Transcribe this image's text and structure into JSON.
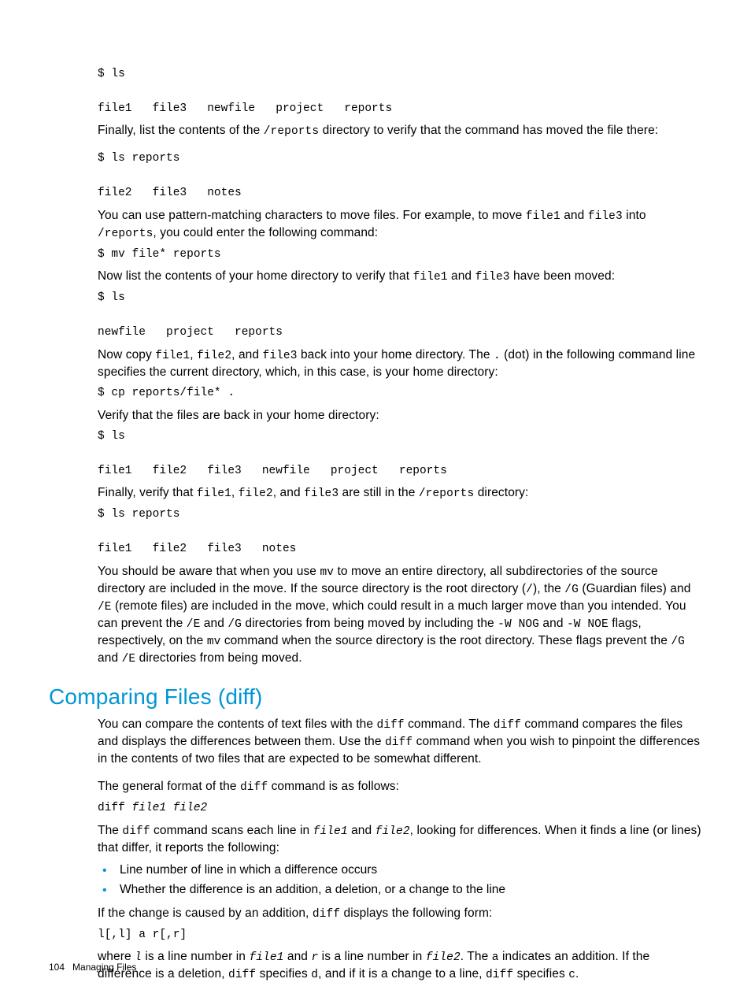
{
  "code1": "$ ls\n\nfile1   file3   newfile   project   reports",
  "para1_a": "Finally, list the contents of the ",
  "para1_code1": "/reports",
  "para1_b": " directory to verify that the command has moved the file there:",
  "code2": "$ ls reports\n\nfile2   file3   notes",
  "para2_a": "You can use pattern-matching characters to move files. For example, to move ",
  "para2_code1": "file1",
  "para2_b": " and ",
  "para2_code2": "file3",
  "para2_c": " into ",
  "para2_code3": "/reports",
  "para2_d": ", you could enter the following command:",
  "code3": "$ mv file* reports",
  "para3_a": "Now list the contents of your home directory to verify that ",
  "para3_code1": "file1",
  "para3_b": " and ",
  "para3_code2": "file3",
  "para3_c": " have been moved:",
  "code4": "$ ls\n\nnewfile   project   reports",
  "para4_a": "Now copy ",
  "para4_code1": "file1",
  "para4_b": ", ",
  "para4_code2": "file2",
  "para4_c": ", and ",
  "para4_code3": "file3",
  "para4_d": " back into your home directory. The ",
  "para4_code4": ".",
  "para4_e": " (dot) in the following command line specifies the current directory, which, in this case, is your home directory:",
  "code5": "$ cp reports/file* .",
  "para5": "Verify that the files are back in your home directory:",
  "code6": "$ ls\n\nfile1   file2   file3   newfile   project   reports",
  "para6_a": "Finally, verify that ",
  "para6_code1": "file1",
  "para6_b": ", ",
  "para6_code2": "file2",
  "para6_c": ", and ",
  "para6_code3": "file3",
  "para6_d": " are still in the ",
  "para6_code4": "/reports",
  "para6_e": " directory:",
  "code7": "$ ls reports\n\nfile1   file2   file3   notes",
  "para7_a": "You should be aware that when you use ",
  "para7_code1": "mv",
  "para7_b": " to move an entire directory, all subdirectories of the source directory are included in the move. If the source directory is the root directory (",
  "para7_code2": "/",
  "para7_c": "), the ",
  "para7_code3": "/G",
  "para7_d": " (Guardian files) and ",
  "para7_code4": "/E",
  "para7_e": " (remote files) are included in the move, which could result in a much larger move than you intended. You can prevent the ",
  "para7_code5": "/E",
  "para7_f": " and ",
  "para7_code6": "/G",
  "para7_g": " directories from being moved by including the ",
  "para7_code7": "-W NOG",
  "para7_h": " and ",
  "para7_code8": "-W NOE",
  "para7_i": " flags, respectively, on the ",
  "para7_code9": "mv",
  "para7_j": " command when the source directory is the root directory. These flags prevent the ",
  "para7_code10": "/G",
  "para7_k": " and ",
  "para7_code11": "/E",
  "para7_l": " directories from being moved.",
  "heading": "Comparing Files (diff)",
  "para8_a": "You can compare the contents of text files with the ",
  "para8_code1": "diff",
  "para8_b": " command. The ",
  "para8_code2": "diff",
  "para8_c": " command compares the files and displays the differences between them. Use the ",
  "para8_code3": "diff",
  "para8_d": " command when you wish to pinpoint the differences in the contents of two files that are expected to be somewhat different.",
  "para9_a": "The general format of the ",
  "para9_code1": "diff",
  "para9_b": " command is as follows:",
  "code8_a": "diff ",
  "code8_b": "file1 file2",
  "para10_a": "The ",
  "para10_code1": "diff",
  "para10_b": " command scans each line in ",
  "para10_code2": "file1",
  "para10_c": " and ",
  "para10_code3": "file2",
  "para10_d": ", looking for differences. When it finds a line (or lines) that differ, it reports the following:",
  "bullet1": "Line number of line in which a difference occurs",
  "bullet2": "Whether the difference is an addition, a deletion, or a change to the line",
  "para11_a": "If the change is caused by an addition, ",
  "para11_code1": "diff",
  "para11_b": " displays the following form:",
  "code9": "l[,l] a r[,r]",
  "para12_a": "where ",
  "para12_code1": "l",
  "para12_b": " is a line number in ",
  "para12_code2": "file1",
  "para12_c": " and ",
  "para12_code3": "r",
  "para12_d": " is a line number in ",
  "para12_code4": "file2",
  "para12_e": ". The ",
  "para12_code5": "a",
  "para12_f": " indicates an addition. If the difference is a deletion, ",
  "para12_code6": "diff",
  "para12_g": " specifies ",
  "para12_code7": "d",
  "para12_h": ", and if it is a change to a line, ",
  "para12_code8": "diff",
  "para12_i": " specifies ",
  "para12_code9": "c",
  "para12_j": ".",
  "page_num": "104",
  "page_title": "Managing Files"
}
